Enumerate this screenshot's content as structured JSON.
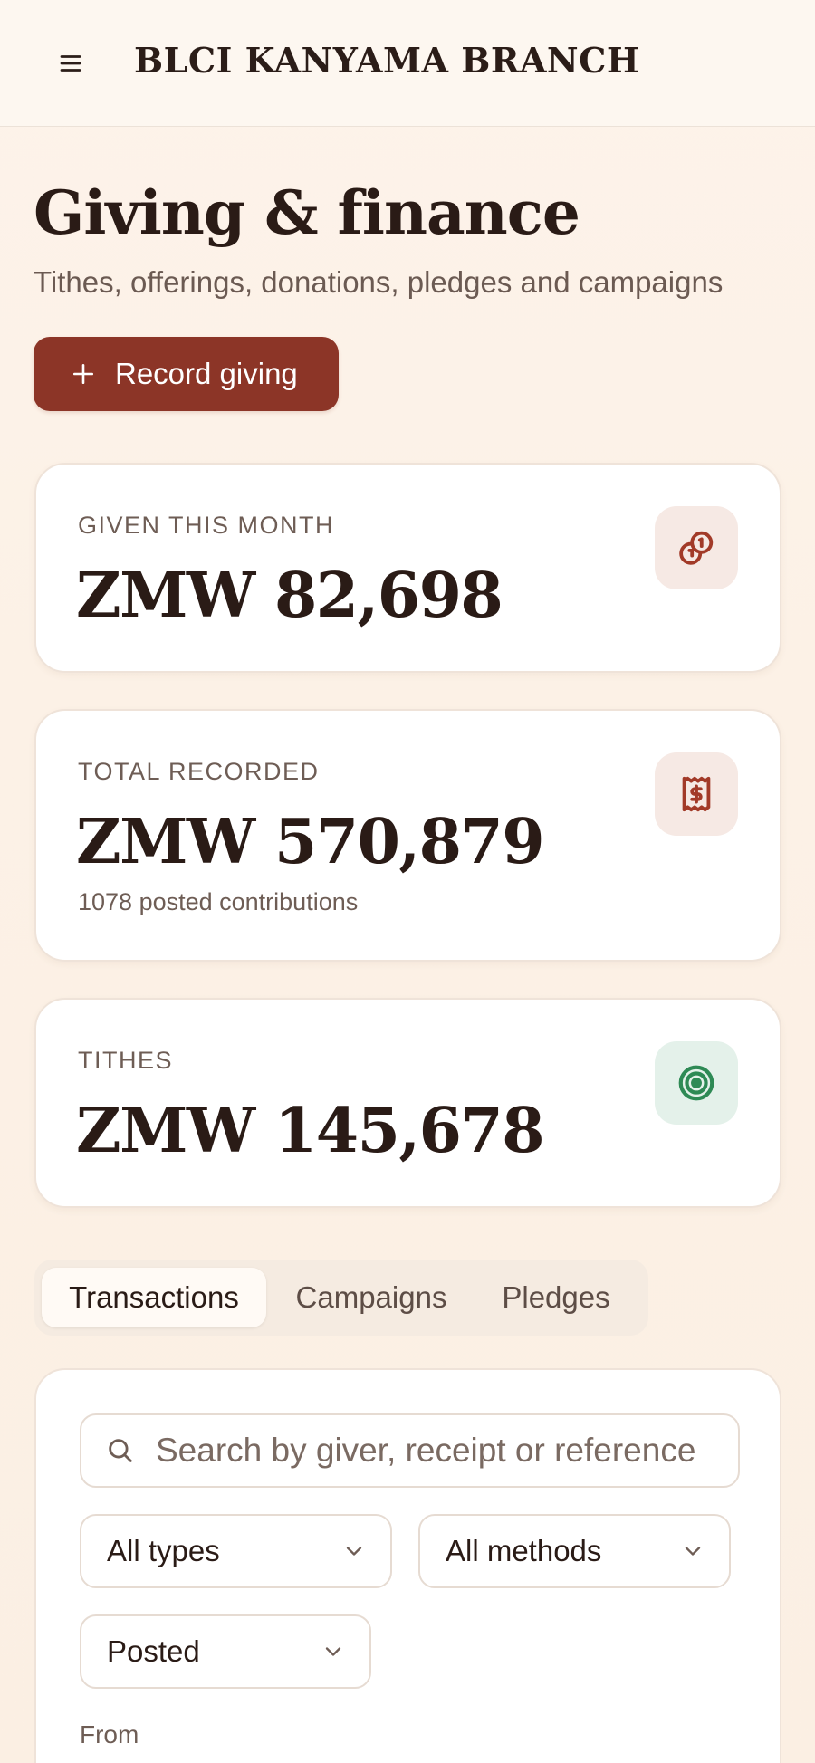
{
  "header": {
    "brand": "BLCI KANYAMA BRANCH",
    "menu_icon": "hamburger-menu-icon"
  },
  "page": {
    "title": "Giving & finance",
    "subtitle": "Tithes, offerings, donations, pledges and campaigns",
    "record_button": "Record giving",
    "record_icon": "plus-icon"
  },
  "stats": [
    {
      "label": "GIVEN THIS MONTH",
      "value": "ZMW 82,698",
      "note": "",
      "icon": "coins-icon",
      "icon_color": "#a23a28",
      "icon_bg": "#f6e9e4"
    },
    {
      "label": "TOTAL RECORDED",
      "value": "ZMW 570,879",
      "note": "1078 posted contributions",
      "icon": "receipt-icon",
      "icon_color": "#a23a28",
      "icon_bg": "#f6e9e4"
    },
    {
      "label": "TITHES",
      "value": "ZMW 145,678",
      "note": "",
      "icon": "target-icon",
      "icon_color": "#2e8a55",
      "icon_bg": "#e4f1ea"
    }
  ],
  "tabs": [
    {
      "label": "Transactions",
      "active": true
    },
    {
      "label": "Campaigns",
      "active": false
    },
    {
      "label": "Pledges",
      "active": false
    }
  ],
  "filters": {
    "search_placeholder": "Search by giver, receipt or reference",
    "search_value": "",
    "type_selected": "All types",
    "method_selected": "All methods",
    "status_selected": "Posted",
    "from_label": "From"
  },
  "colors": {
    "accent": "#8c3527",
    "background": "#fcf1e6",
    "text": "#2a1b16",
    "muted": "#6e5d55"
  }
}
